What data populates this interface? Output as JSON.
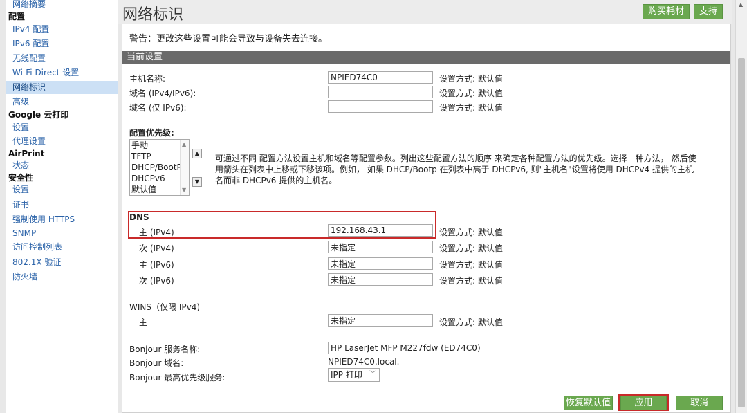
{
  "sidebar": {
    "items": [
      {
        "label": "网络摘要",
        "type": "link"
      },
      {
        "label": "配置",
        "type": "head"
      },
      {
        "label": "IPv4 配置",
        "type": "link"
      },
      {
        "label": "IPv6 配置",
        "type": "link"
      },
      {
        "label": "无线配置",
        "type": "link"
      },
      {
        "label": "Wi-Fi Direct 设置",
        "type": "link"
      },
      {
        "label": "网络标识",
        "type": "link",
        "active": true
      },
      {
        "label": "高级",
        "type": "link"
      },
      {
        "label": "Google 云打印",
        "type": "head"
      },
      {
        "label": "设置",
        "type": "link"
      },
      {
        "label": "代理设置",
        "type": "link"
      },
      {
        "label": "AirPrint",
        "type": "head"
      },
      {
        "label": "状态",
        "type": "link"
      },
      {
        "label": "安全性",
        "type": "head"
      },
      {
        "label": "设置",
        "type": "link"
      },
      {
        "label": "证书",
        "type": "link"
      },
      {
        "label": "强制使用 HTTPS",
        "type": "link"
      },
      {
        "label": "SNMP",
        "type": "link"
      },
      {
        "label": "访问控制列表",
        "type": "link"
      },
      {
        "label": "802.1X 验证",
        "type": "link"
      },
      {
        "label": "防火墙",
        "type": "link"
      }
    ]
  },
  "header": {
    "title": "网络标识",
    "buy_supplies": "购买耗材",
    "support": "支持"
  },
  "main": {
    "warning": "警告：更改这些设置可能会导致与设备失去连接。",
    "section_title": "当前设置",
    "method_text": "设置方式:  默认值",
    "hostname_label": "主机名称:",
    "hostname_value": "NPIED74C0",
    "domain_label": "域名 (IPv4/IPv6):",
    "domain_value": "",
    "domain6_label": "域名 (仅 IPv6):",
    "domain6_value": "",
    "priority_label": "配置优先级:",
    "priority_options": [
      "手动",
      "TFTP",
      "DHCP/BootP",
      "DHCPv6",
      "默认值"
    ],
    "priority_description": "可通过不同 配置方法设置主机和域名等配置参数。列出这些配置方法的顺序 来确定各种配置方法的优先级。选择一种方法， 然后使用箭头在列表中上移或下移该项。例如， 如果 DHCP/Bootp 在列表中高于 DHCPv6, 则\"主机名\"设置将使用 DHCPv4 提供的主机名而非 DHCPv6 提供的主机名。",
    "dns_label": "DNS",
    "dns_primary_v4_label": "主 (IPv4)",
    "dns_primary_v4_value": "192.168.43.1",
    "dns_secondary_v4_label": "次 (IPv4)",
    "dns_secondary_v4_value": "未指定",
    "dns_primary_v6_label": "主 (IPv6)",
    "dns_primary_v6_value": "未指定",
    "dns_secondary_v6_label": "次 (IPv6)",
    "dns_secondary_v6_value": "未指定",
    "wins_label": "WINS（仅限 IPv4)",
    "wins_primary_label": "主",
    "wins_primary_value": "未指定",
    "bonjour_name_label": "Bonjour 服务名称:",
    "bonjour_name_value": "HP LaserJet MFP M227fdw (ED74C0)",
    "bonjour_domain_label": "Bonjour 域名:",
    "bonjour_domain_value": "NPIED74C0.local.",
    "bonjour_priority_label": "Bonjour 最高优先级服务:",
    "bonjour_priority_value": "IPP 打印",
    "restore_defaults": "恢复默认值",
    "apply": "应用",
    "cancel": "取消"
  },
  "colors": {
    "accent_green": "#6aa84f",
    "highlight_red": "#c92a2a",
    "section_bar": "#6a6a6a",
    "link_blue": "#2a62a8"
  }
}
